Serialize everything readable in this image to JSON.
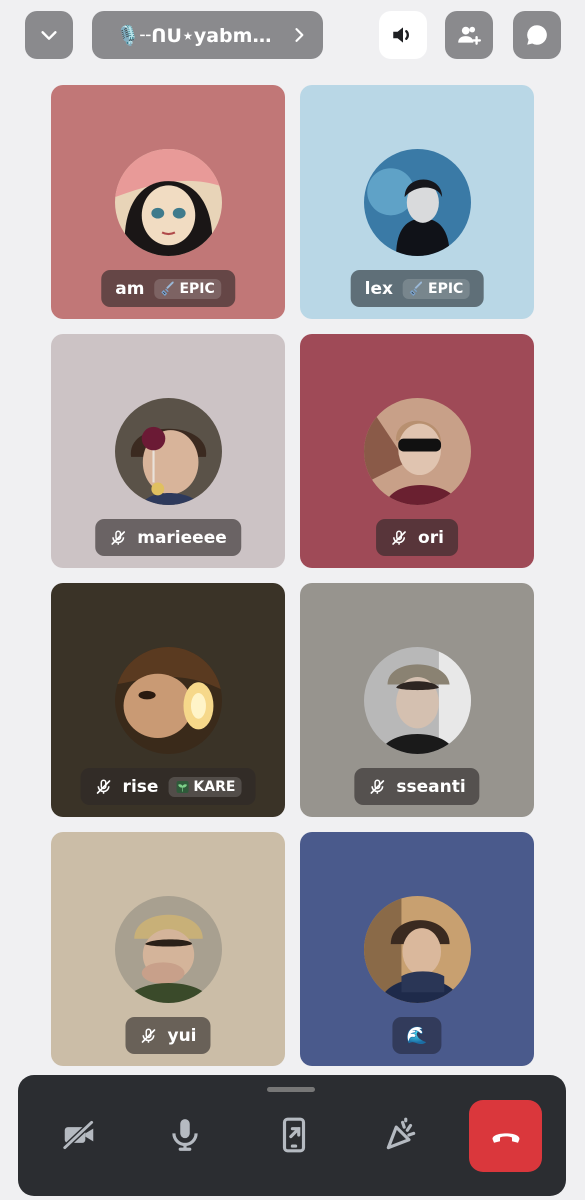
{
  "header": {
    "channel_name": "🎙️╌ᑎᑌ⋆yabm…",
    "buttons": {
      "collapse": "chevron-down-icon",
      "speaker": "speaker-icon",
      "invite": "add-user-icon",
      "chat": "chat-icon"
    }
  },
  "participants": [
    {
      "name": "am",
      "muted": false,
      "badge": "EPIC",
      "badge_icon": "sword-icon",
      "bg": "#c17777"
    },
    {
      "name": "lex",
      "muted": false,
      "badge": "EPIC",
      "badge_icon": "sword-icon",
      "bg": "#b9d7e6"
    },
    {
      "name": "marieeee",
      "muted": true,
      "badge": "",
      "bg": "#ccc3c5"
    },
    {
      "name": "ori",
      "muted": true,
      "badge": "",
      "bg": "#9f4a57"
    },
    {
      "name": "rise",
      "muted": true,
      "badge": "KARE",
      "badge_icon": "sprout-icon",
      "bg": "#3a3327"
    },
    {
      "name": "sseanti",
      "muted": true,
      "badge": "",
      "bg": "#97948e"
    },
    {
      "name": "yui",
      "muted": true,
      "badge": "",
      "bg": "#cbbda7"
    },
    {
      "name": "🌊",
      "muted": false,
      "badge": "",
      "bg": "#4a5a8c"
    }
  ],
  "controls": {
    "camera": "camera-off-icon",
    "mic": "microphone-icon",
    "screenshare": "screen-share-icon",
    "soundboard": "soundboard-icon",
    "hangup": "hang-up-icon",
    "hangup_color": "#da373c"
  }
}
